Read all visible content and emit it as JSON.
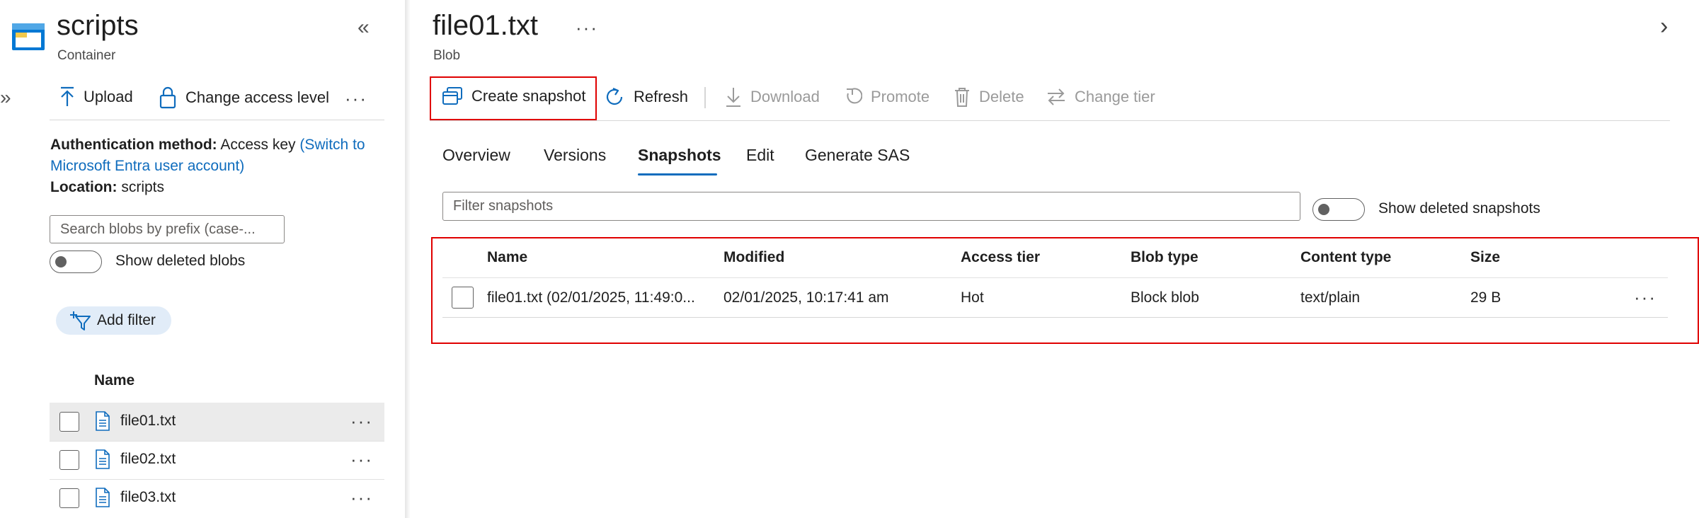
{
  "container": {
    "title": "scripts",
    "subtitle": "Container",
    "collapse_glyph": "«",
    "expand_glyph": "»"
  },
  "left_toolbar": {
    "upload": "Upload",
    "change_access": "Change access level",
    "more": "···"
  },
  "auth": {
    "method_label": "Authentication method:",
    "method_value": "Access key",
    "switch_link": "(Switch to Microsoft Entra user account)",
    "location_label": "Location:",
    "location_value": "scripts"
  },
  "search": {
    "placeholder": "Search blobs by prefix (case-..."
  },
  "show_deleted_blobs": {
    "label": "Show deleted blobs",
    "on": false
  },
  "add_filter": "Add filter",
  "blob_list": {
    "header": "Name",
    "items": [
      {
        "name": "file01.txt",
        "selected": true
      },
      {
        "name": "file02.txt",
        "selected": false
      },
      {
        "name": "file03.txt",
        "selected": false
      }
    ],
    "more": "···"
  },
  "blob": {
    "title": "file01.txt",
    "subtitle": "Blob",
    "more": "···",
    "chevron": "›"
  },
  "right_toolbar": {
    "create_snapshot": "Create snapshot",
    "refresh": "Refresh",
    "download": "Download",
    "promote": "Promote",
    "delete": "Delete",
    "change_tier": "Change tier"
  },
  "tabs": [
    {
      "label": "Overview",
      "active": false
    },
    {
      "label": "Versions",
      "active": false
    },
    {
      "label": "Snapshots",
      "active": true
    },
    {
      "label": "Edit",
      "active": false
    },
    {
      "label": "Generate SAS",
      "active": false
    }
  ],
  "filter_snapshots": {
    "placeholder": "Filter snapshots"
  },
  "show_deleted_snapshots": {
    "label": "Show deleted snapshots",
    "on": false
  },
  "snapshots": {
    "columns": [
      "Name",
      "Modified",
      "Access tier",
      "Blob type",
      "Content type",
      "Size"
    ],
    "rows": [
      {
        "name": "file01.txt (02/01/2025, 11:49:0...",
        "modified": "02/01/2025, 10:17:41 am",
        "access_tier": "Hot",
        "blob_type": "Block blob",
        "content_type": "text/plain",
        "size": "29 B"
      }
    ],
    "more": "···"
  },
  "colors": {
    "accent": "#0f6cbd",
    "highlight_box": "#e00000",
    "selected_row": "#ebebeb",
    "pill_bg": "#e1ecf8"
  }
}
